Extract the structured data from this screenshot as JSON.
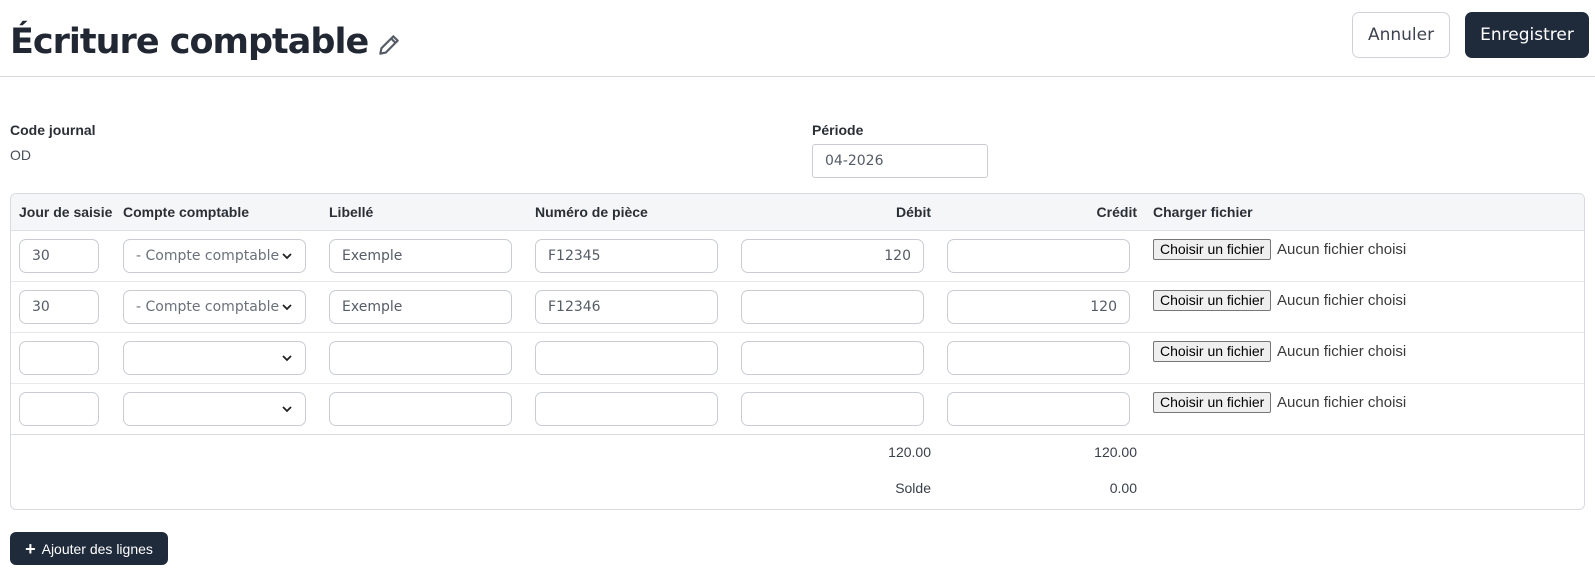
{
  "header": {
    "title": "Écriture comptable",
    "cancel_label": "Annuler",
    "save_label": "Enregistrer"
  },
  "journal": {
    "label": "Code journal",
    "value": "OD"
  },
  "period": {
    "label": "Période",
    "value": "04-2026"
  },
  "table": {
    "columns": [
      "Jour de saisie",
      "Compte comptable",
      "Libellé",
      "Numéro de pièce",
      "Débit",
      "Crédit",
      "Charger fichier"
    ],
    "rows": [
      {
        "day": "30",
        "account": "- Compte comptable",
        "libelle": "Exemple",
        "piece": "F12345",
        "debit": "120",
        "credit": ""
      },
      {
        "day": "30",
        "account": "- Compte comptable",
        "libelle": "Exemple",
        "piece": "F12346",
        "debit": "",
        "credit": "120"
      },
      {
        "day": "",
        "account": "",
        "libelle": "",
        "piece": "",
        "debit": "",
        "credit": ""
      },
      {
        "day": "",
        "account": "",
        "libelle": "",
        "piece": "",
        "debit": "",
        "credit": ""
      }
    ],
    "file_button_label": "Choisir un fichier",
    "file_status": "Aucun fichier choisi",
    "totals": {
      "debit": "120.00",
      "credit": "120.00"
    },
    "balance": {
      "label": "Solde",
      "value": "0.00"
    }
  },
  "add_lines_label": "Ajouter des lignes",
  "icons": {
    "title": "pencil-icon",
    "add": "plus-icon",
    "select": "chevron-down-icon"
  },
  "colors": {
    "primary": "#1f2a3b",
    "border": "#c9cdd3",
    "header_bg": "#f5f6f8"
  }
}
